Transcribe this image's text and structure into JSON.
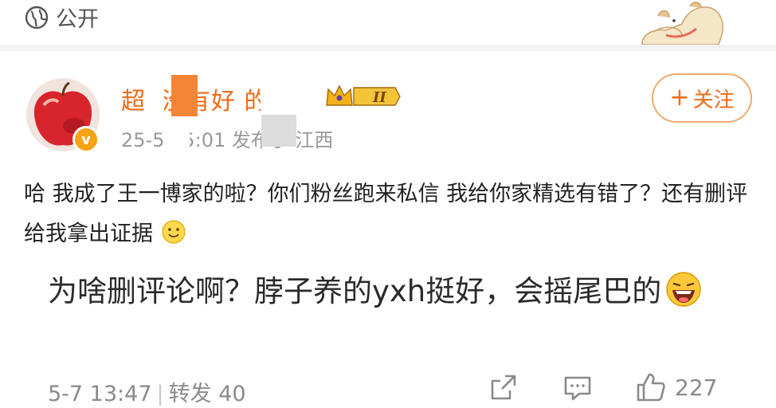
{
  "top": {
    "visibility_label": "公开",
    "globe_icon": "globe-icon"
  },
  "post": {
    "username": "超i 没有好 的",
    "level_badge": "II",
    "verified_badge": "v",
    "meta": "25-5  15:01  发布于 江西",
    "follow_label": "关注",
    "body": "哈 我成了王一博家的啦？你们粉丝跑来私信 我给你家精选有错了？还有删评给我拿出证据",
    "quote": "为啥删评论啊？脖子养的yxh挺好，会摇尾巴的",
    "footer": {
      "timestamp": "5-7 13:47",
      "repost_label": "转发 40",
      "like_count": "227"
    }
  },
  "colors": {
    "accent": "#f06a16",
    "follow_border": "#f0aa6f",
    "muted": "#8a8a8a"
  }
}
